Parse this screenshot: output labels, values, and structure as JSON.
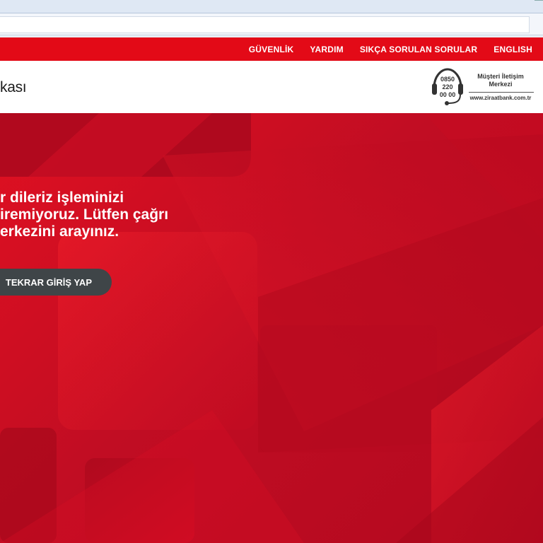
{
  "nav": {
    "items": [
      "GÜVENLİK",
      "YARDIM",
      "SIKÇA SORULAN SORULAR",
      "ENGLISH"
    ]
  },
  "header": {
    "brand_partial": "kası",
    "contact": {
      "phone_line1": "0850",
      "phone_line2": "220",
      "phone_line3": "00 00",
      "title_line1": "Müşteri İletişim",
      "title_line2": "Merkezi",
      "url": "www.ziraatbank.com.tr"
    }
  },
  "hero": {
    "message_lines": [
      "r dileriz işleminizi",
      "iremiyoruz. Lütfen çağrı",
      "erkezini arayınız."
    ],
    "retry_label": "TEKRAR GİRİŞ YAP"
  },
  "colors": {
    "nav_red": "#e30a17",
    "hero_red": "#c10d23",
    "button_dark": "#3f4548"
  },
  "icons": {
    "headset": "headset-icon"
  }
}
